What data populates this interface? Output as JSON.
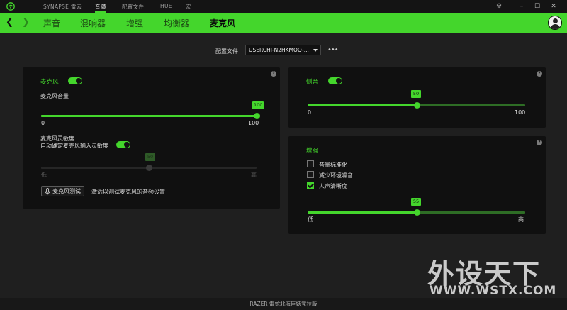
{
  "titlebar": {
    "tabs": [
      "SYNAPSE 雷云",
      "音频",
      "配置文件",
      "HUE",
      "宏"
    ],
    "active_tab": "音频"
  },
  "nav": {
    "tabs": [
      "声音",
      "混响器",
      "增强",
      "均衡器",
      "麦克风"
    ],
    "active_tab": "麦克风"
  },
  "profile": {
    "label": "配置文件",
    "value": "USERCHI-N2HKMOQ-...",
    "more": "•••"
  },
  "mic_panel": {
    "title": "麦克风",
    "enabled": true,
    "volume_label": "麦克风音量",
    "volume_value": "100",
    "volume_min": "0",
    "volume_max": "100",
    "sensitivity_label": "麦克风灵敏度",
    "auto_sensitivity_label": "自动确定麦克风输入灵敏度",
    "auto_sensitivity_enabled": true,
    "sensitivity_value": "50",
    "sensitivity_min": "低",
    "sensitivity_max": "高",
    "test_button": "麦克风测试",
    "test_hint": "激活以测试麦克风的音频设置"
  },
  "sidetone_panel": {
    "title": "侧音",
    "enabled": true,
    "value": "50",
    "min": "0",
    "max": "100"
  },
  "enhance_panel": {
    "title": "增强",
    "options": [
      {
        "label": "音量标准化",
        "checked": false
      },
      {
        "label": "减少环境噪音",
        "checked": false
      },
      {
        "label": "人声清晰度",
        "checked": true
      }
    ],
    "value": "55",
    "min": "低",
    "max": "高"
  },
  "watermark": {
    "text": "外设天下",
    "url": "WWW.WSTX.COM"
  },
  "footer": {
    "text": "RAZER 雷蛇北海巨妖竞技版"
  },
  "colors": {
    "accent": "#44d62c",
    "background": "#1f1f1f",
    "panel": "#101010"
  }
}
